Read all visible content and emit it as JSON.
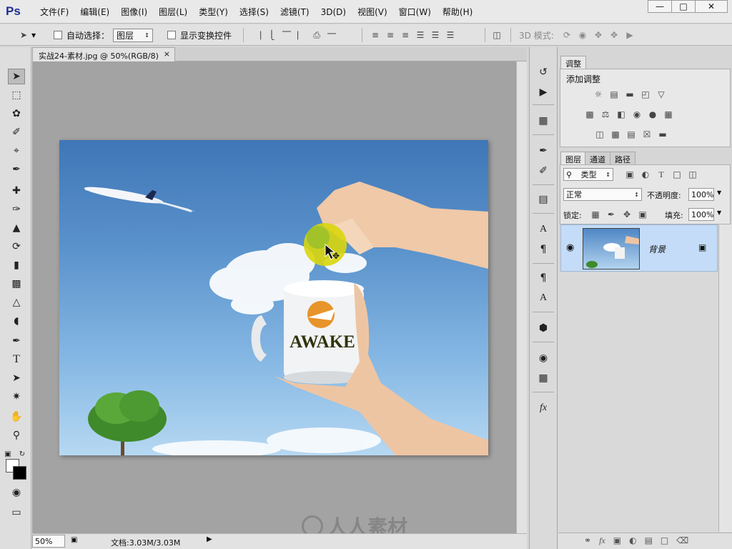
{
  "app": {
    "logo": "Ps",
    "menu": [
      "文件(F)",
      "编辑(E)",
      "图像(I)",
      "图层(L)",
      "类型(Y)",
      "选择(S)",
      "滤镜(T)",
      "3D(D)",
      "视图(V)",
      "窗口(W)",
      "帮助(H)"
    ],
    "window_buttons": [
      "minimize",
      "maximize",
      "close"
    ]
  },
  "options_bar": {
    "auto_select_label": "自动选择：",
    "auto_select_target": "图层",
    "show_transform_label": "显示变换控件",
    "mode_3d_label": "3D 模式:"
  },
  "document": {
    "tab_title": "实战24-素材.jpg @ 50%(RGB/8)",
    "tab_close": "×",
    "zoom": "50%",
    "doc_info": "文档:3.03M/3.03M",
    "mug_text": "AWAKE"
  },
  "adjustments_panel": {
    "tab": "调整",
    "heading": "添加调整"
  },
  "layers_panel": {
    "tabs": [
      "图层",
      "通道",
      "路径"
    ],
    "filter_label": "类型",
    "blend_mode": "正常",
    "opacity_label": "不透明度:",
    "opacity_value": "100%",
    "lock_label": "锁定:",
    "fill_label": "填充:",
    "fill_value": "100%",
    "layers": [
      {
        "name": "背景",
        "visible": true,
        "locked": true
      }
    ]
  },
  "watermark": "人人素材",
  "colors": {
    "selected_layer_bg": "#c4dcf7",
    "accent": "#1e2f8f"
  }
}
